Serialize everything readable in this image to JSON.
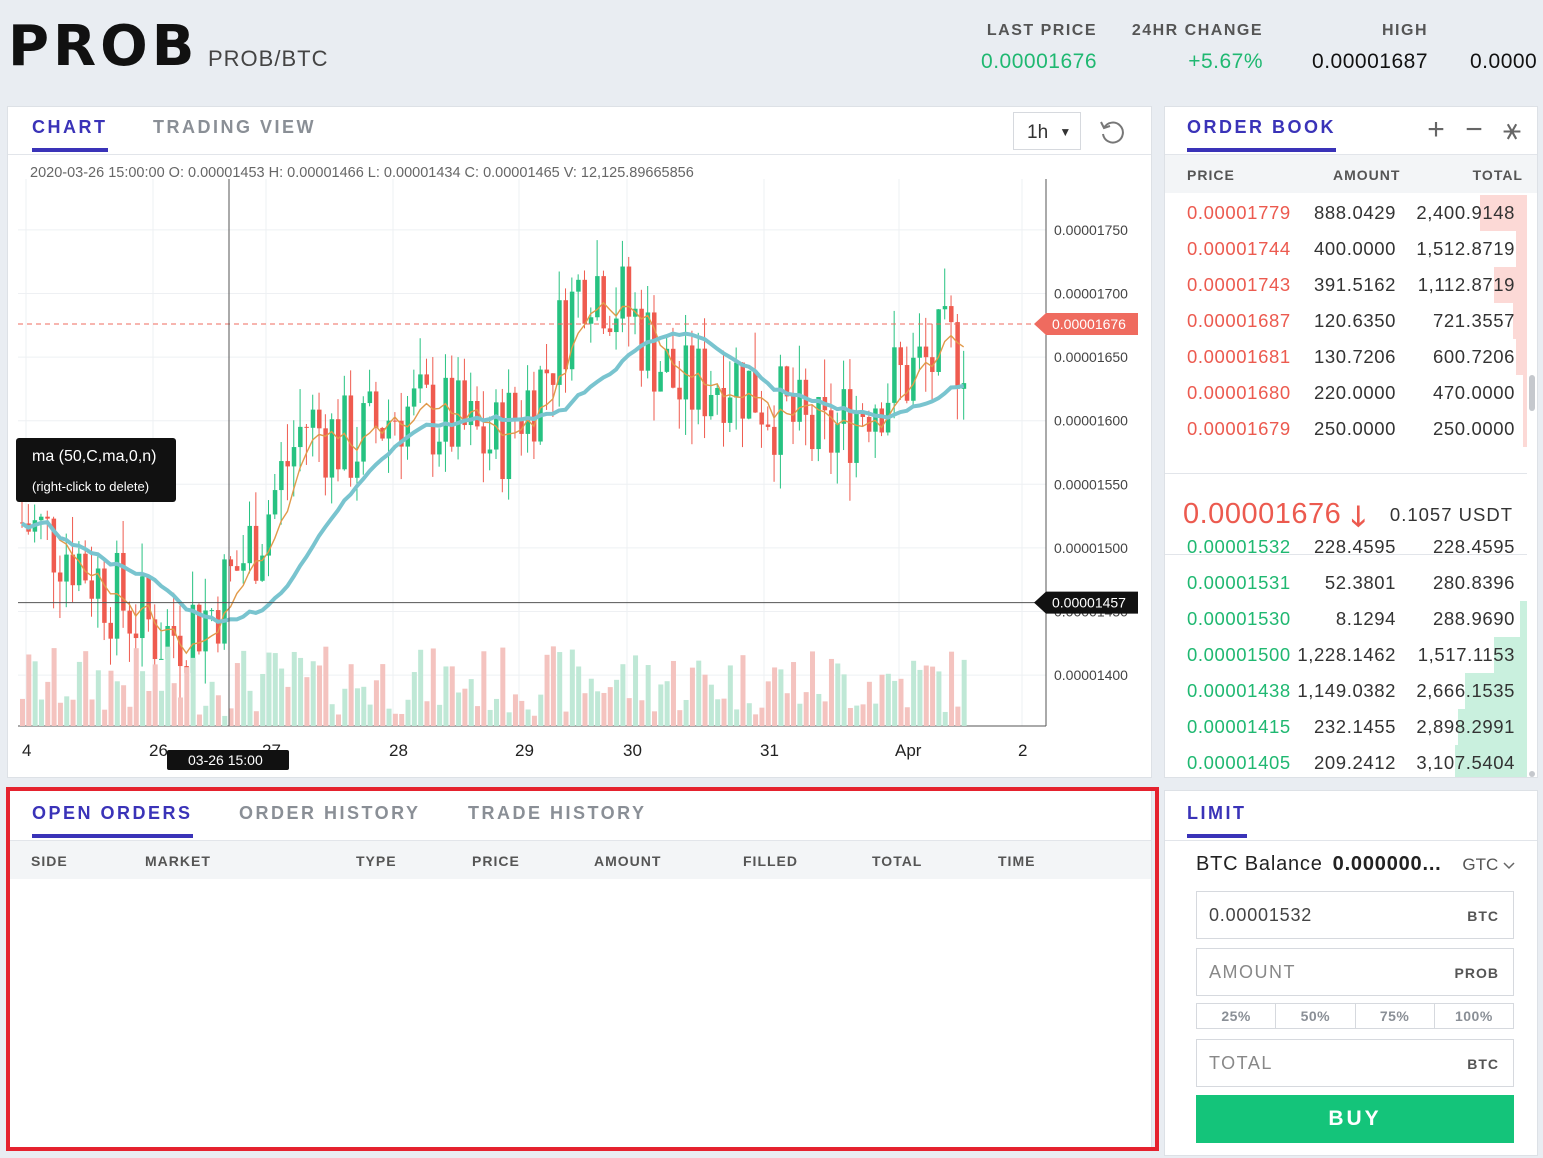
{
  "header": {
    "symbol": "PROB",
    "pair": "PROB/BTC",
    "stats": [
      {
        "label": "LAST PRICE",
        "value": "0.00001676",
        "color": "#1fb871"
      },
      {
        "label": "24HR CHANGE",
        "value": "+5.67%",
        "color": "#1fb871"
      },
      {
        "label": "HIGH",
        "value": "0.00001687",
        "color": "#111111"
      },
      {
        "label": "",
        "value": "0.0000",
        "color": "#111111"
      }
    ]
  },
  "chart_panel": {
    "tabs": [
      "CHART",
      "TRADING VIEW"
    ],
    "interval": "1h",
    "legend": "2020-03-26 15:00:00   O: 0.00001453   H: 0.00001466   L: 0.00001434   C: 0.00001465   V: 12,125.89665856",
    "tooltip_title": "ma (50,C,ma,0,n)",
    "tooltip_sub": "(right-click to delete)",
    "crosshair_time": "03-26 15:00",
    "crosshair_price": "0.00001457",
    "last_price_tag": "0.00001676"
  },
  "chart_data": {
    "type": "candlestick",
    "x_ticks": [
      "4",
      "26",
      "27",
      "28",
      "29",
      "30",
      "31",
      "Apr",
      "2"
    ],
    "y_ticks": [
      "0.00001750",
      "0.00001700",
      "0.00001650",
      "0.00001600",
      "0.00001550",
      "0.00001500",
      "0.00001450",
      "0.00001400"
    ],
    "ylim": [
      1.36e-05,
      1.79e-05
    ],
    "grid": true,
    "colors": {
      "up": "#26c281",
      "down": "#ef5b4f",
      "ma_fast": "#e19a4a",
      "ma_slow": "#79c4cf"
    }
  },
  "order_book": {
    "title": "ORDER BOOK",
    "tools": [
      "+",
      "−",
      "⚹"
    ],
    "columns": [
      "PRICE",
      "AMOUNT",
      "TOTAL"
    ],
    "asks": [
      {
        "price": "0.00001779",
        "amount": "888.0429",
        "total": "2,400.9148",
        "depth": 0.13
      },
      {
        "price": "0.00001744",
        "amount": "400.0000",
        "total": "1,512.8719",
        "depth": 0.03
      },
      {
        "price": "0.00001743",
        "amount": "391.5162",
        "total": "1,112.8719",
        "depth": 0.09
      },
      {
        "price": "0.00001687",
        "amount": "120.6350",
        "total": "721.3557",
        "depth": 0.04
      },
      {
        "price": "0.00001681",
        "amount": "130.7206",
        "total": "600.7206",
        "depth": 0.03
      },
      {
        "price": "0.00001680",
        "amount": "220.0000",
        "total": "470.0000",
        "depth": 0.01
      },
      {
        "price": "0.00001679",
        "amount": "250.0000",
        "total": "250.0000",
        "depth": 0.01
      }
    ],
    "last_price": "0.00001676",
    "last_price_usd": "0.1057 USDT",
    "bids": [
      {
        "price": "0.00001532",
        "amount": "228.4595",
        "total": "228.4595",
        "depth": 0.0
      },
      {
        "price": "0.00001531",
        "amount": "52.3801",
        "total": "280.8396",
        "depth": 0.0
      },
      {
        "price": "0.00001530",
        "amount": "8.1294",
        "total": "288.9690",
        "depth": 0.02
      },
      {
        "price": "0.00001500",
        "amount": "1,228.1462",
        "total": "1,517.1153",
        "depth": 0.09
      },
      {
        "price": "0.00001438",
        "amount": "1,149.0382",
        "total": "2,666.1535",
        "depth": 0.17
      },
      {
        "price": "0.00001415",
        "amount": "232.1455",
        "total": "2,898.2991",
        "depth": 0.19
      },
      {
        "price": "0.00001405",
        "amount": "209.2412",
        "total": "3,107.5404",
        "depth": 0.2
      }
    ]
  },
  "orders": {
    "tabs": [
      "OPEN ORDERS",
      "ORDER HISTORY",
      "TRADE HISTORY"
    ],
    "columns": [
      "SIDE",
      "MARKET",
      "TYPE",
      "PRICE",
      "AMOUNT",
      "FILLED",
      "TOTAL",
      "TIME"
    ]
  },
  "limit": {
    "tab": "LIMIT",
    "balance_label": "BTC Balance",
    "balance_value": "0.000000...",
    "tif": "GTC",
    "price_value": "0.00001532",
    "price_unit": "BTC",
    "amount_placeholder": "AMOUNT",
    "amount_unit": "PROB",
    "percents": [
      "25%",
      "50%",
      "75%",
      "100%"
    ],
    "total_placeholder": "TOTAL",
    "total_unit": "BTC",
    "buy_label": "BUY"
  }
}
